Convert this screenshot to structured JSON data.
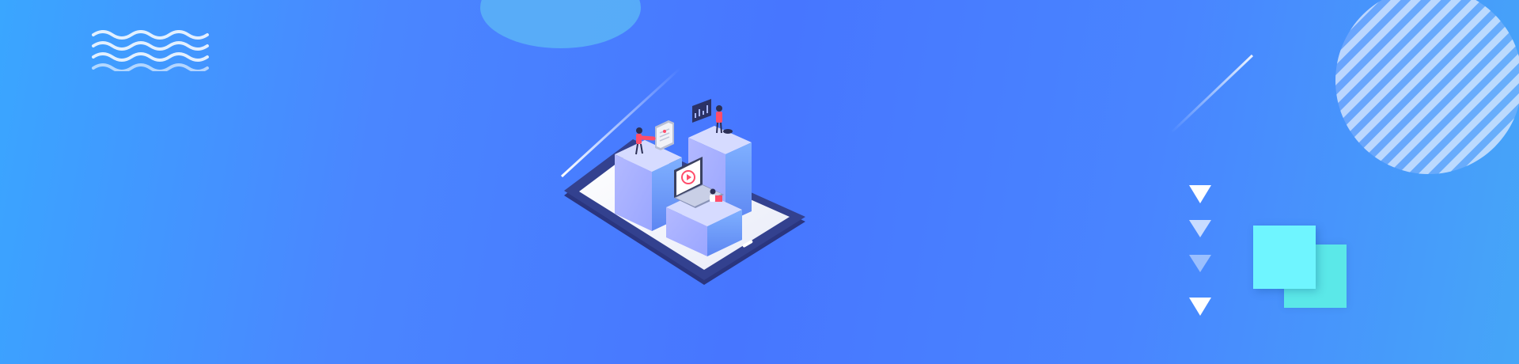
{
  "banner": {
    "colors": {
      "background_start": "#3aa6ff",
      "background_mid": "#4776ff",
      "background_end": "#45a6f8",
      "accent_cyan": "#6ff5ff",
      "accent_teal": "#5be8e8",
      "tablet_frame": "#2f3c8e",
      "pillar_light": "#c9d2ff",
      "figure_red": "#ff4d6a"
    },
    "decorations": [
      "wave-lines-icon",
      "top-ellipse",
      "diagonal-line",
      "striped-circle",
      "triangle-markers",
      "overlapping-squares"
    ],
    "illustration": {
      "name": "isometric-tablet-scene",
      "elements": [
        "tablet",
        "left-pillar",
        "right-pillar",
        "front-pillar",
        "laptop-with-play-icon",
        "clipboard-icon",
        "chart-board-icon",
        "people-figures"
      ]
    }
  }
}
